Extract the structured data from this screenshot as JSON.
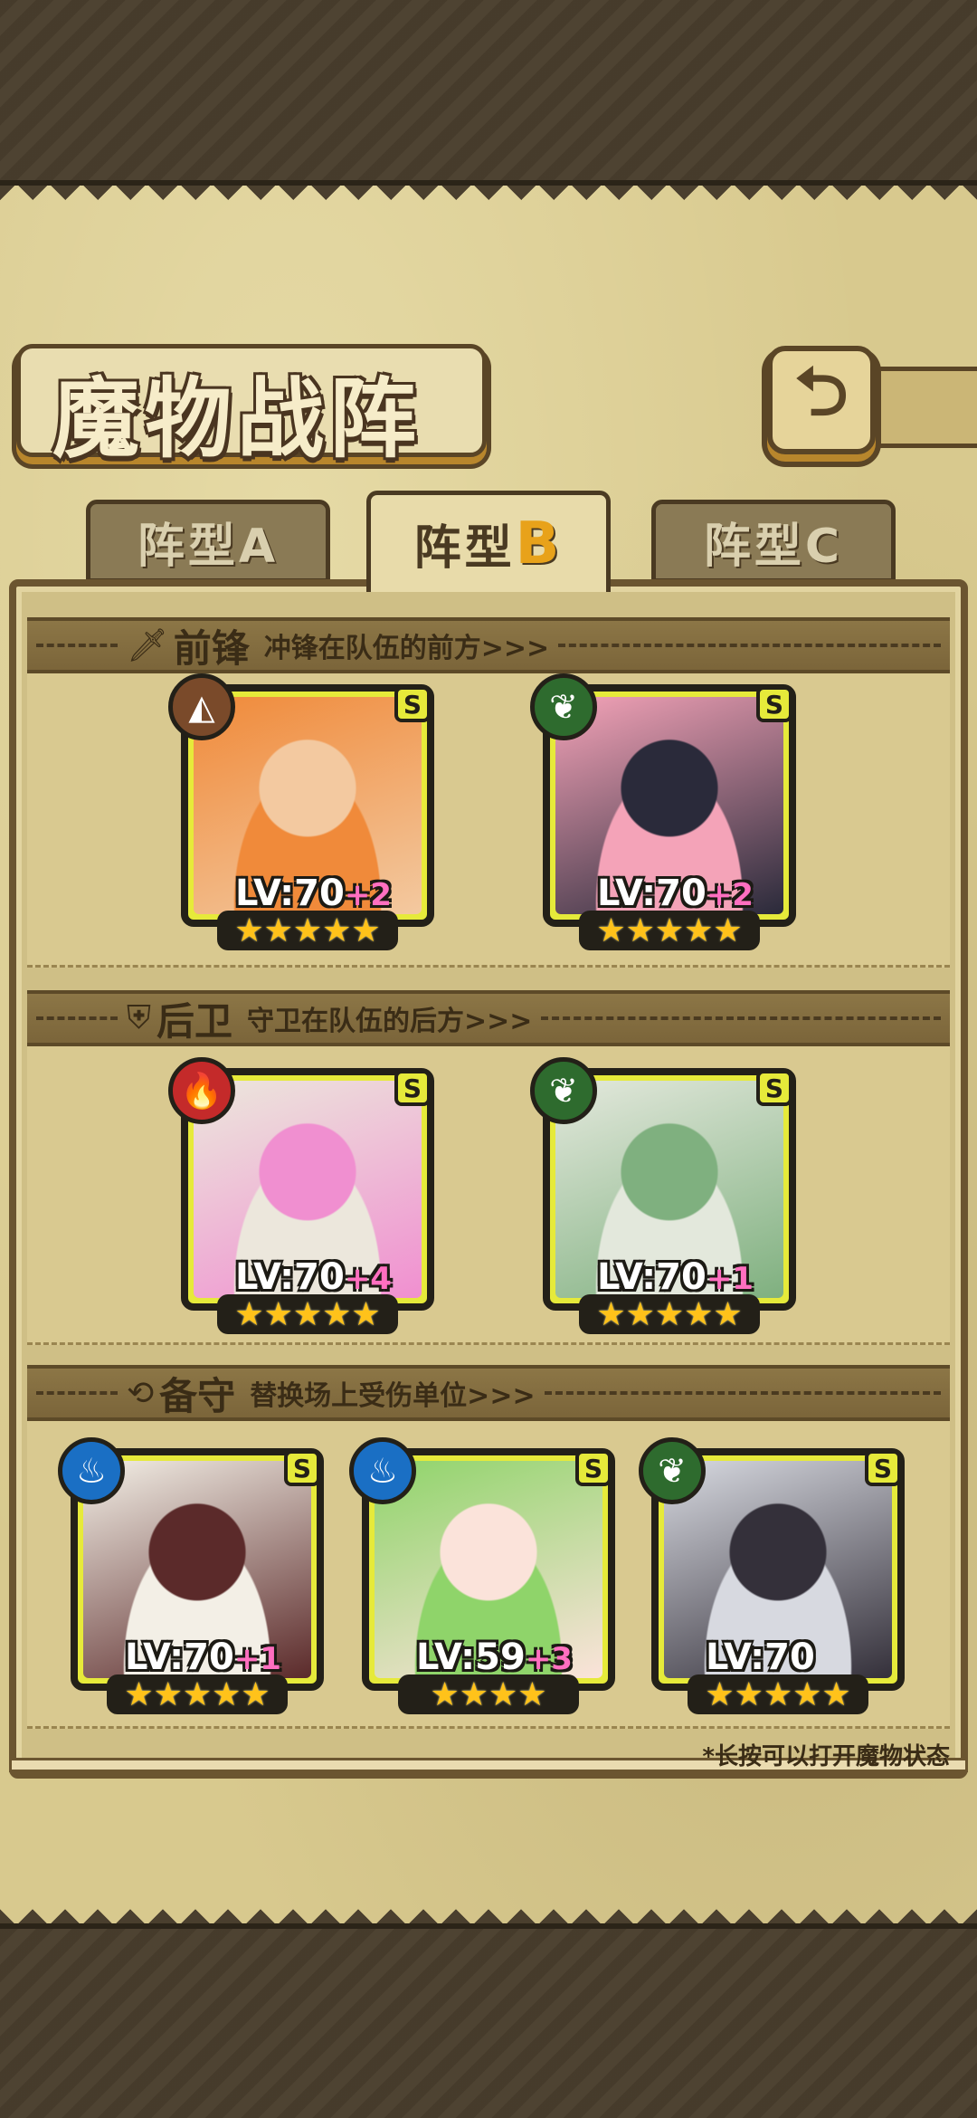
{
  "screen": {
    "title": "魔物战阵",
    "back_icon": "return-arrow-icon"
  },
  "tabs": [
    {
      "label": "阵型A",
      "active": false
    },
    {
      "label": "阵型",
      "suffix": "B",
      "active": true
    },
    {
      "label": "阵型C",
      "active": false
    }
  ],
  "sections": {
    "front": {
      "icon": "sword-icon",
      "title": "前锋",
      "desc": "冲锋在队伍的前方>>>"
    },
    "back": {
      "icon": "shield-icon",
      "title": "后卫",
      "desc": "守卫在队伍的后方>>>"
    },
    "reserve": {
      "icon": "swap-arrows-icon",
      "title": "备守",
      "desc": "替换场上受伤单位>>>"
    }
  },
  "cards": {
    "front_1": {
      "rank": "S",
      "element": "earth",
      "element_color": "#7a4a2a",
      "level": "LV:70",
      "plus": "+2",
      "stars": "★★★★★",
      "palette": [
        "#f08a3a",
        "#f3c9a0"
      ]
    },
    "front_2": {
      "rank": "S",
      "element": "leaf",
      "element_color": "#2e6b2e",
      "level": "LV:70",
      "plus": "+2",
      "stars": "★★★★★",
      "palette": [
        "#f4a3b8",
        "#2a2a3a"
      ]
    },
    "back_1": {
      "rank": "S",
      "element": "fire",
      "element_color": "#c42a2a",
      "level": "LV:70",
      "plus": "+4",
      "stars": "★★★★★",
      "palette": [
        "#ece7dc",
        "#f08fd0"
      ]
    },
    "back_2": {
      "rank": "S",
      "element": "leaf",
      "element_color": "#2e6b2e",
      "level": "LV:70",
      "plus": "+1",
      "stars": "★★★★★",
      "palette": [
        "#e3e8dc",
        "#7fb07f"
      ]
    },
    "reserve_1": {
      "rank": "S",
      "element": "water",
      "element_color": "#1a6fc4",
      "level": "LV:70",
      "plus": "+1",
      "stars": "★★★★★",
      "palette": [
        "#f3efe6",
        "#5b2a2a"
      ]
    },
    "reserve_2": {
      "rank": "S",
      "element": "water",
      "element_color": "#1a6fc4",
      "level": "LV:59",
      "plus": "+3",
      "stars": "★★★★",
      "palette": [
        "#8fd46a",
        "#fbe3da"
      ]
    },
    "reserve_3": {
      "rank": "S",
      "element": "leaf",
      "element_color": "#2e6b2e",
      "level": "LV:70",
      "plus": "",
      "stars": "★★★★★",
      "palette": [
        "#d7d9e0",
        "#34303a"
      ]
    }
  },
  "footer": {
    "hint": "*长按可以打开魔物状态"
  }
}
